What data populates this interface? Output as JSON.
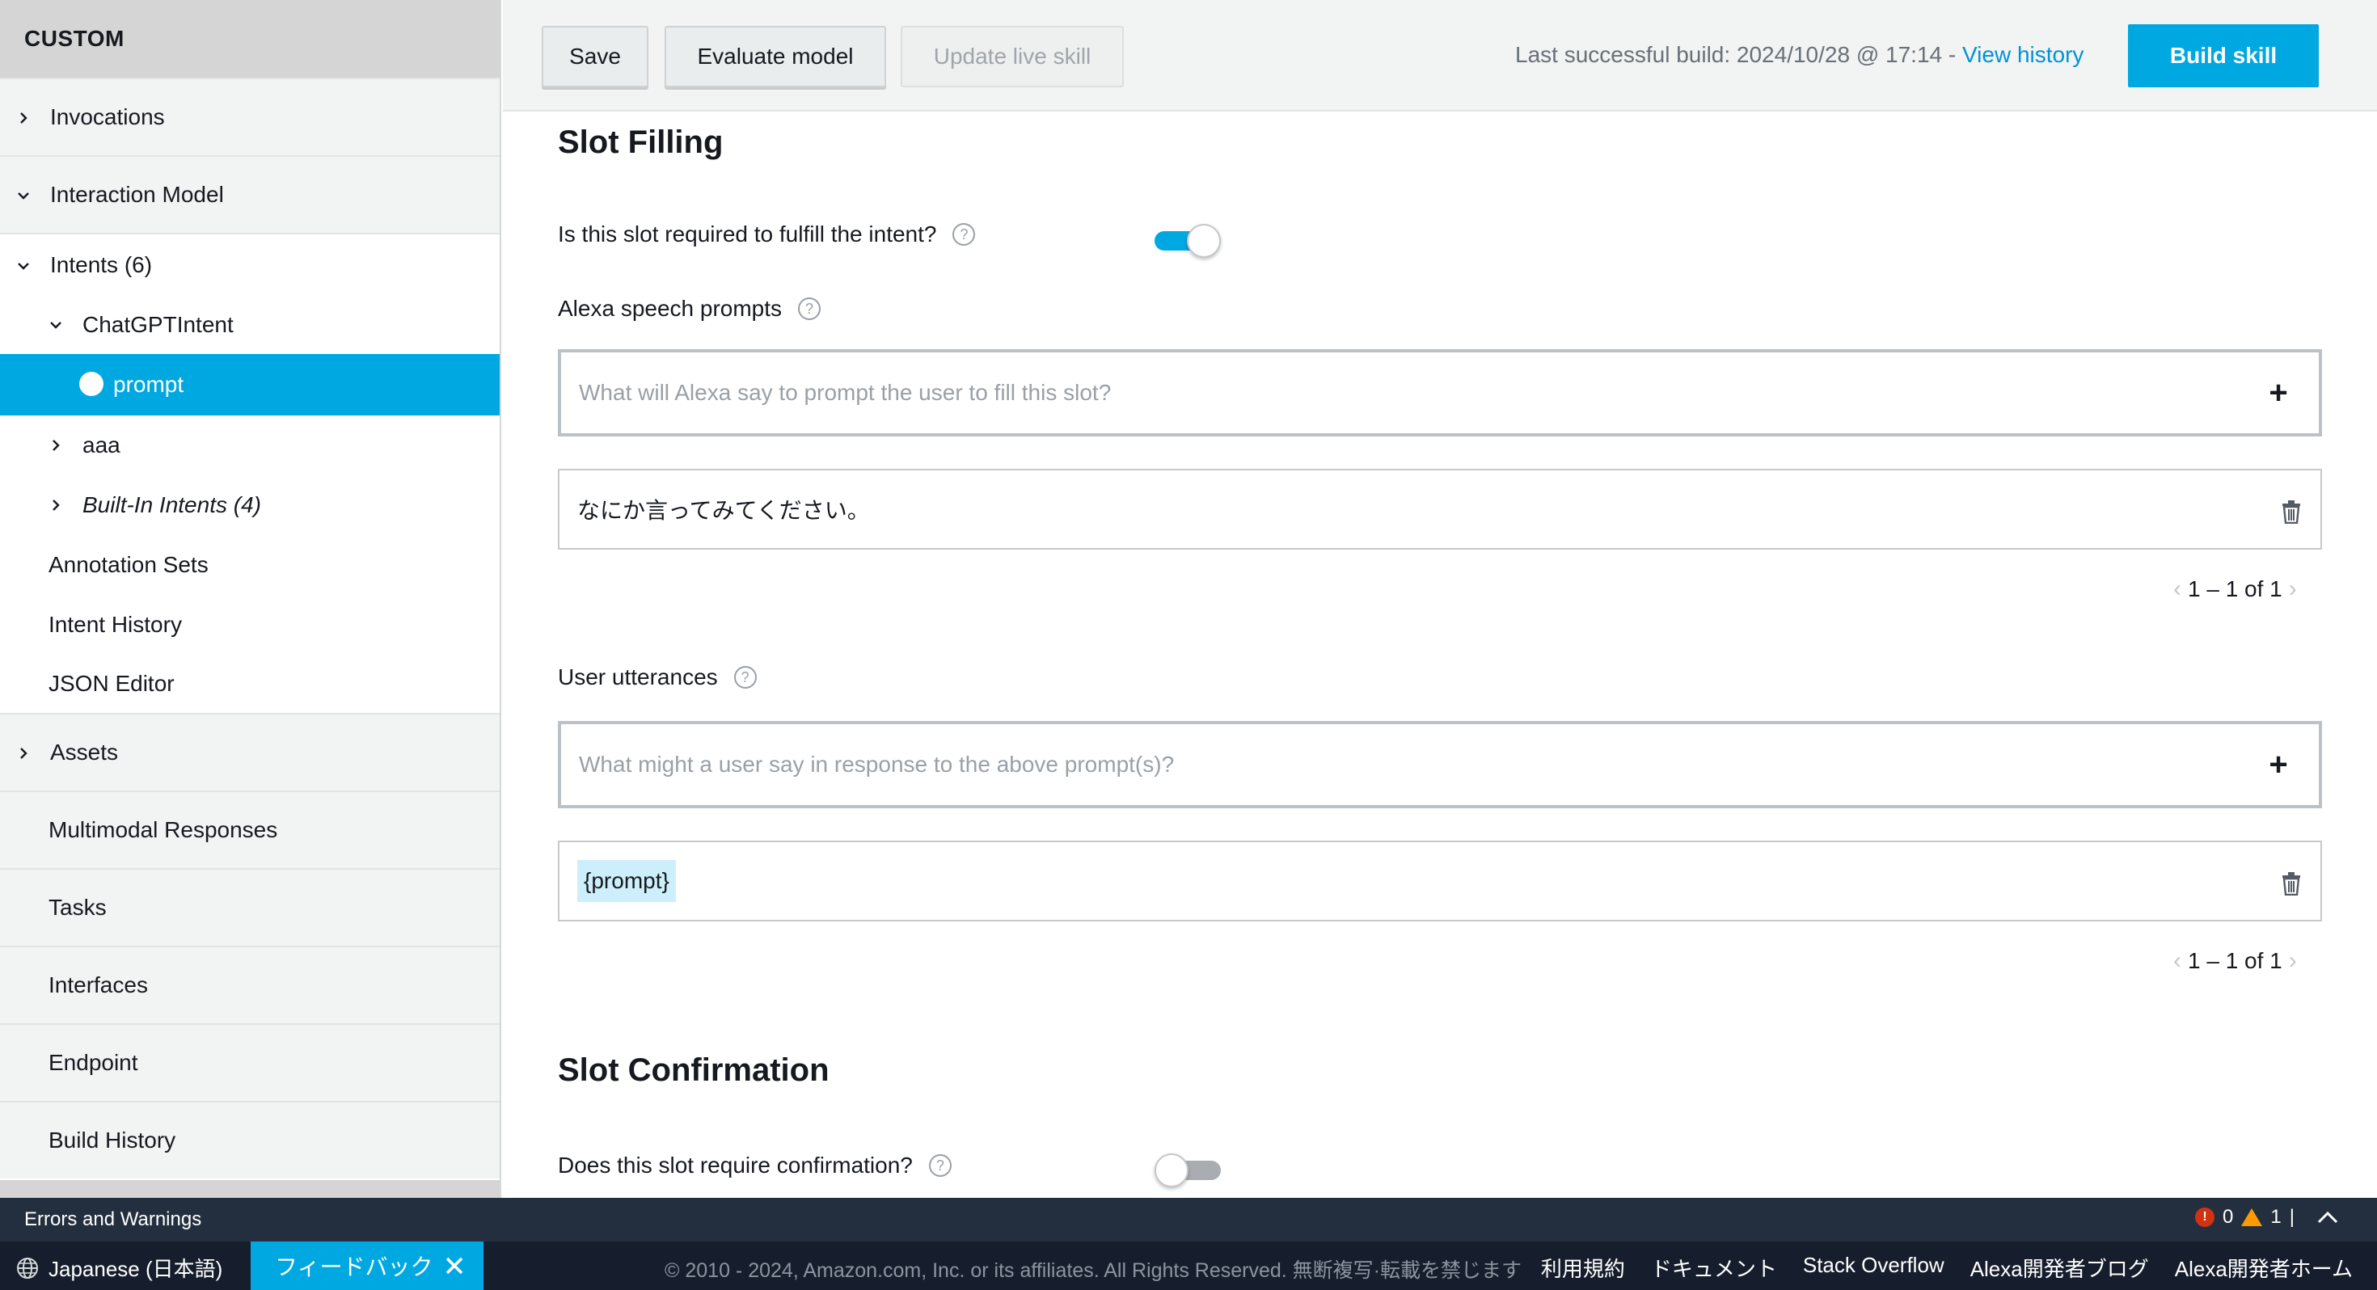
{
  "sidebar": {
    "header": "CUSTOM",
    "invocations": "Invocations",
    "interaction_model": "Interaction Model",
    "intents": "Intents (6)",
    "chatgpt_intent": "ChatGPTIntent",
    "prompt": "prompt",
    "aaa": "aaa",
    "builtin_intents": "Built-In Intents (4)",
    "annotation_sets": "Annotation Sets",
    "intent_history": "Intent History",
    "json_editor": "JSON Editor",
    "assets": "Assets",
    "multimodal": "Multimodal Responses",
    "tasks": "Tasks",
    "interfaces": "Interfaces",
    "endpoint": "Endpoint",
    "build_history": "Build History"
  },
  "toolbar": {
    "save": "Save",
    "evaluate": "Evaluate model",
    "update_live": "Update live skill",
    "last_build_prefix": "Last successful build: 2024/10/28 @ 17:14 - ",
    "view_history": "View history",
    "build_skill": "Build skill"
  },
  "main": {
    "slot_filling_title": "Slot Filling",
    "required_label": "Is this slot required to fulfill the intent?",
    "required_on": true,
    "speech_prompts_label": "Alexa speech prompts",
    "speech_placeholder": "What will Alexa say to prompt the user to fill this slot?",
    "speech_entry": "なにか言ってみてください。",
    "speech_pager": "1 – 1 of 1",
    "utterances_label": "User utterances",
    "utterance_placeholder": "What might a user say in response to the above prompt(s)?",
    "utterance_entry": "{prompt}",
    "utterance_pager": "1 – 1 of 1",
    "slot_confirmation_title": "Slot Confirmation",
    "confirm_label": "Does this slot require confirmation?",
    "confirm_on": false
  },
  "errors_bar": {
    "label": "Errors and Warnings",
    "error_count": "0",
    "warning_count": "1",
    "separator": "|"
  },
  "footer": {
    "language": "Japanese (日本語)",
    "feedback": "フィードバック",
    "copyright": "© 2010 - 2024, Amazon.com, Inc. or its affiliates. All Rights Reserved. 無断複写·転載を禁じます",
    "links": [
      "利用規約",
      "ドキュメント",
      "Stack Overflow",
      "Alexa開発者ブログ",
      "Alexa開発者ホーム"
    ]
  },
  "colors": {
    "accent": "#00a8e1",
    "nav_dark": "#232f3e",
    "footer_dark": "#161e2d",
    "error": "#d13212",
    "warning": "#ff9900"
  }
}
